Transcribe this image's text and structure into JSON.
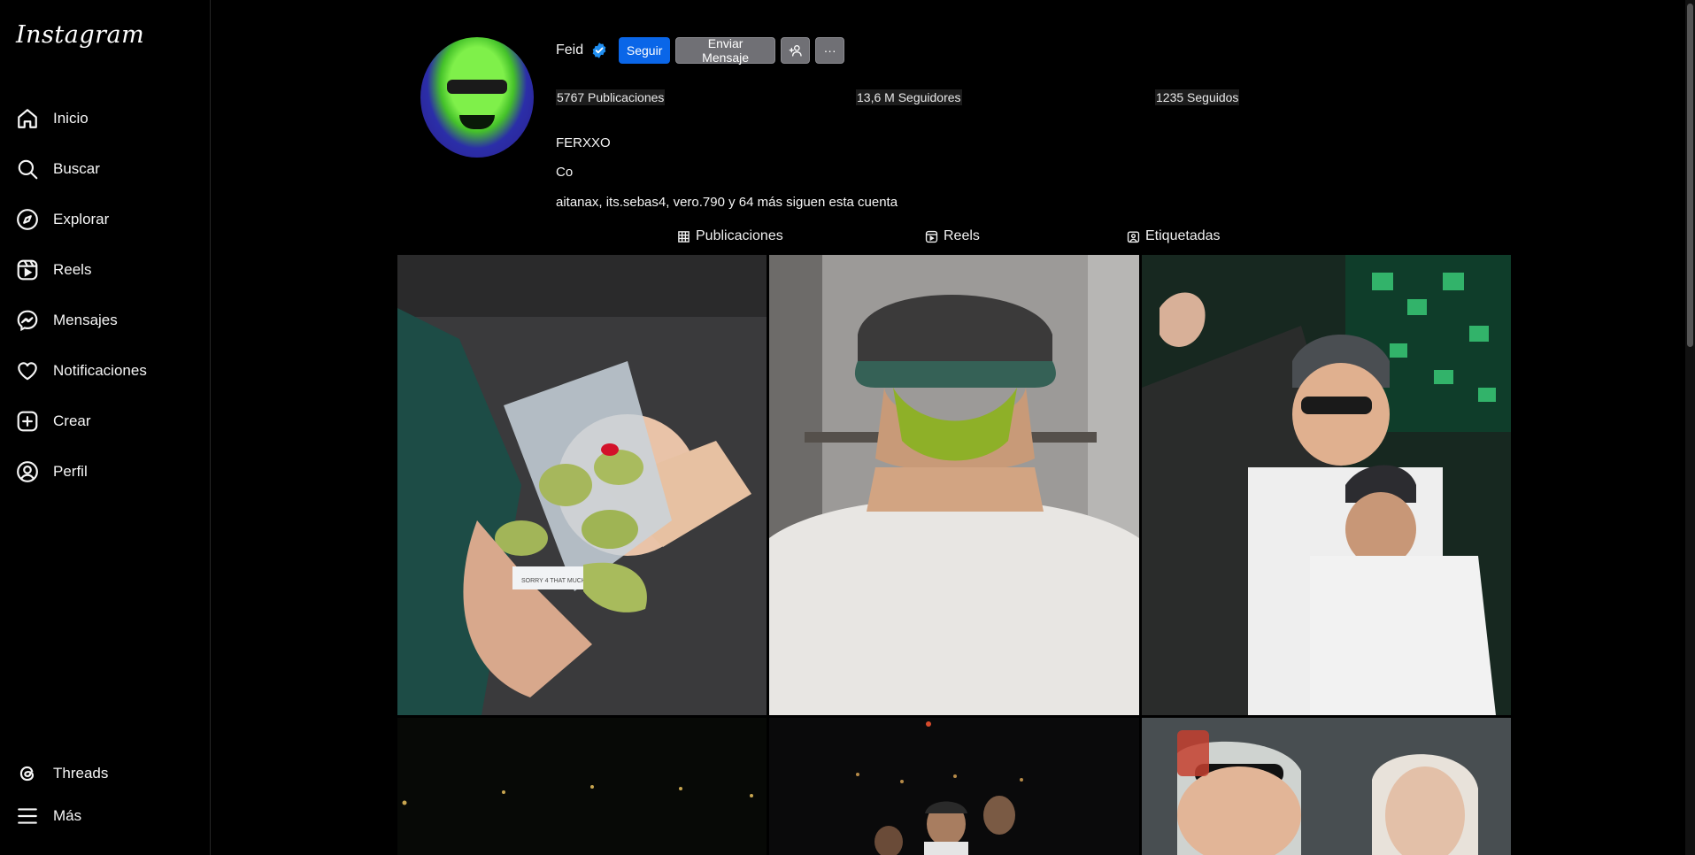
{
  "app": {
    "logo_text": "Instagram"
  },
  "sidebar": {
    "items": [
      {
        "label": "Inicio",
        "icon": "home-icon"
      },
      {
        "label": "Buscar",
        "icon": "search-icon"
      },
      {
        "label": "Explorar",
        "icon": "compass-icon"
      },
      {
        "label": "Reels",
        "icon": "reels-icon"
      },
      {
        "label": "Mensajes",
        "icon": "messenger-icon"
      },
      {
        "label": "Notificaciones",
        "icon": "heart-icon"
      },
      {
        "label": "Crear",
        "icon": "plus-square-icon"
      },
      {
        "label": "Perfil",
        "icon": "profile-icon"
      }
    ],
    "bottom": [
      {
        "label": "Threads",
        "icon": "threads-icon"
      },
      {
        "label": "Más",
        "icon": "menu-icon"
      }
    ]
  },
  "profile": {
    "username": "Feid",
    "verified": true,
    "buttons": {
      "follow": "Seguir",
      "message": "Enviar Mensaje",
      "more": "···"
    },
    "stats": {
      "posts": "5767 Publicaciones",
      "followers": "13,6 M Seguidores",
      "following": "1235 Seguidos"
    },
    "full_name": "FERXXO",
    "bio": "Co",
    "followed_by": "aitanax, its.sebas4, vero.790 y 64 más siguen esta cuenta"
  },
  "tabs": [
    {
      "label": "Publicaciones",
      "icon": "grid-icon"
    },
    {
      "label": "Reels",
      "icon": "reels-icon"
    },
    {
      "label": "Etiquetadas",
      "icon": "tagged-icon"
    }
  ],
  "posts": [
    {
      "id": "post-1",
      "overlay_text": "SORRY 4 THAT MUCH"
    },
    {
      "id": "post-2"
    },
    {
      "id": "post-3"
    },
    {
      "id": "post-4"
    },
    {
      "id": "post-5"
    },
    {
      "id": "post-6"
    }
  ],
  "colors": {
    "background": "#000000",
    "primary_button": "#0a66e8",
    "secondary_button": "#707075",
    "verified": "#1f8ef1"
  }
}
